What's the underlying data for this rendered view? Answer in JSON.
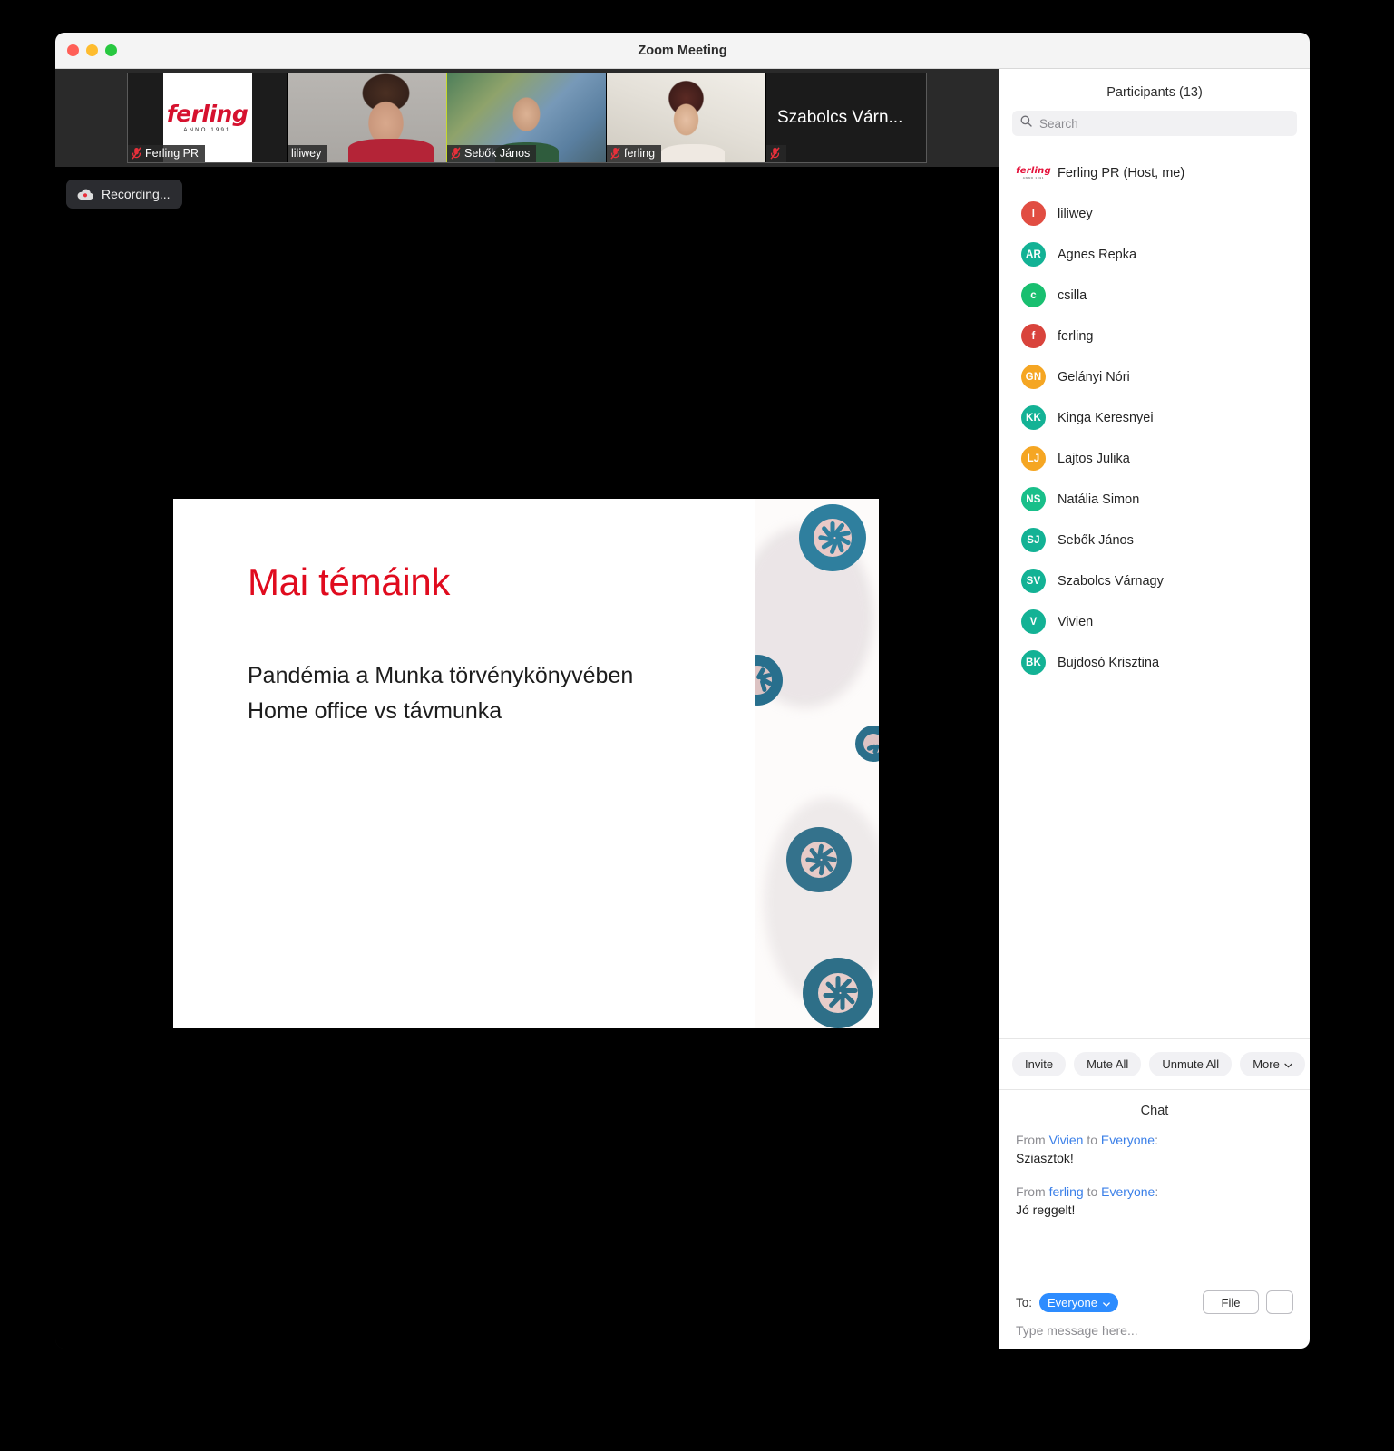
{
  "window": {
    "title": "Zoom Meeting",
    "traffic_lights": [
      "close",
      "minimize",
      "zoom"
    ]
  },
  "filmstrip": {
    "tiles": [
      {
        "label": "Ferling PR",
        "muted": true,
        "active": false,
        "kind": "logo",
        "logo_word": "ferling",
        "logo_sub": "ANNO 1991"
      },
      {
        "label": "liliwey",
        "muted": false,
        "active": true,
        "kind": "video-liliwey"
      },
      {
        "label": "Sebők János",
        "muted": true,
        "active": false,
        "kind": "video-sebok"
      },
      {
        "label": "ferling",
        "muted": true,
        "active": false,
        "kind": "video-ferling"
      },
      {
        "label": "",
        "big_name": "Szabolcs Várn...",
        "muted": true,
        "active": false,
        "kind": "name-only"
      }
    ]
  },
  "recording": {
    "label": "Recording...",
    "icon": "cloud-recording-icon"
  },
  "slide": {
    "title": "Mai témáink",
    "lines": [
      "Pandémia a Munka törvénykönyvében",
      "Home office vs távmunka"
    ],
    "title_color": "#e00b1e",
    "art": "coronavirus-micrograph"
  },
  "panel": {
    "header": "Participants (13)",
    "search": {
      "placeholder": "Search",
      "value": ""
    },
    "participants": [
      {
        "name": "Ferling PR (Host, me)",
        "initials": "",
        "color": "",
        "avatar_kind": "logo"
      },
      {
        "name": "liliwey",
        "initials": "l",
        "color": "#e14d42",
        "avatar_kind": "initials"
      },
      {
        "name": "Agnes Repka",
        "initials": "AR",
        "color": "#13b295",
        "avatar_kind": "initials"
      },
      {
        "name": "csilla",
        "initials": "c",
        "color": "#19bf70",
        "avatar_kind": "initials"
      },
      {
        "name": "ferling",
        "initials": "f",
        "color": "#d9443c",
        "avatar_kind": "initials"
      },
      {
        "name": "Gelányi Nóri",
        "initials": "GN",
        "color": "#f5a623",
        "avatar_kind": "initials"
      },
      {
        "name": "Kinga Keresnyei",
        "initials": "KK",
        "color": "#13b295",
        "avatar_kind": "initials"
      },
      {
        "name": "Lajtos Julika",
        "initials": "LJ",
        "color": "#f5a623",
        "avatar_kind": "initials"
      },
      {
        "name": "Natália Simon",
        "initials": "NS",
        "color": "#19bf8a",
        "avatar_kind": "initials"
      },
      {
        "name": "Sebők János",
        "initials": "SJ",
        "color": "#13b295",
        "avatar_kind": "initials"
      },
      {
        "name": "Szabolcs Várnagy",
        "initials": "SV",
        "color": "#13b295",
        "avatar_kind": "initials"
      },
      {
        "name": "Vivien",
        "initials": "V",
        "color": "#13b295",
        "avatar_kind": "initials"
      },
      {
        "name": "Bujdosó Krisztina",
        "initials": "BK",
        "color": "#13b295",
        "avatar_kind": "initials"
      }
    ],
    "actions": {
      "invite": "Invite",
      "mute_all": "Mute All",
      "unmute_all": "Unmute All",
      "more": "More"
    }
  },
  "chat": {
    "title": "Chat",
    "messages": [
      {
        "prefix": "From ",
        "from": "Vivien",
        "mid": " to ",
        "to": "Everyone",
        "suffix": ":",
        "body": "Sziasztok!"
      },
      {
        "prefix": "From ",
        "from": "ferling",
        "mid": " to ",
        "to": "Everyone",
        "suffix": ":",
        "body": "Jó reggelt!"
      }
    ],
    "compose": {
      "to_label": "To:",
      "to_value": "Everyone",
      "file_button": "File",
      "emoji_button": "",
      "input_placeholder": "Type message here...",
      "input_value": ""
    }
  },
  "colors": {
    "accent_blue": "#2d8cff",
    "brand_red": "#e00b1e",
    "active_speaker": "#c8d82e"
  }
}
